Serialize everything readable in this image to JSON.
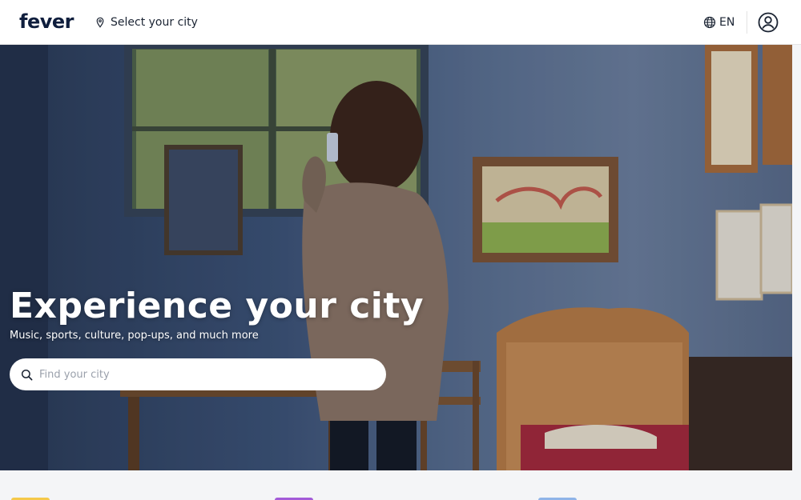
{
  "header": {
    "logo": "fever",
    "city_select_label": "Select your city",
    "language": "EN",
    "icons": {
      "location": "location-pin-icon",
      "globe": "globe-icon",
      "account": "user-account-icon"
    }
  },
  "hero": {
    "title": "Experience your city",
    "subtitle": "Music, sports, culture, pop-ups, and much more",
    "search": {
      "placeholder": "Find your city",
      "value": "",
      "icon": "search-icon"
    }
  },
  "category_tiles": [
    {
      "color": "#f5c94a"
    },
    {
      "color": "#a35bd8"
    },
    {
      "color": "#8fb4e8"
    }
  ],
  "colors": {
    "brand": "#0f1e3d",
    "header_bg": "#ffffff",
    "page_bg": "#f4f5f7"
  }
}
